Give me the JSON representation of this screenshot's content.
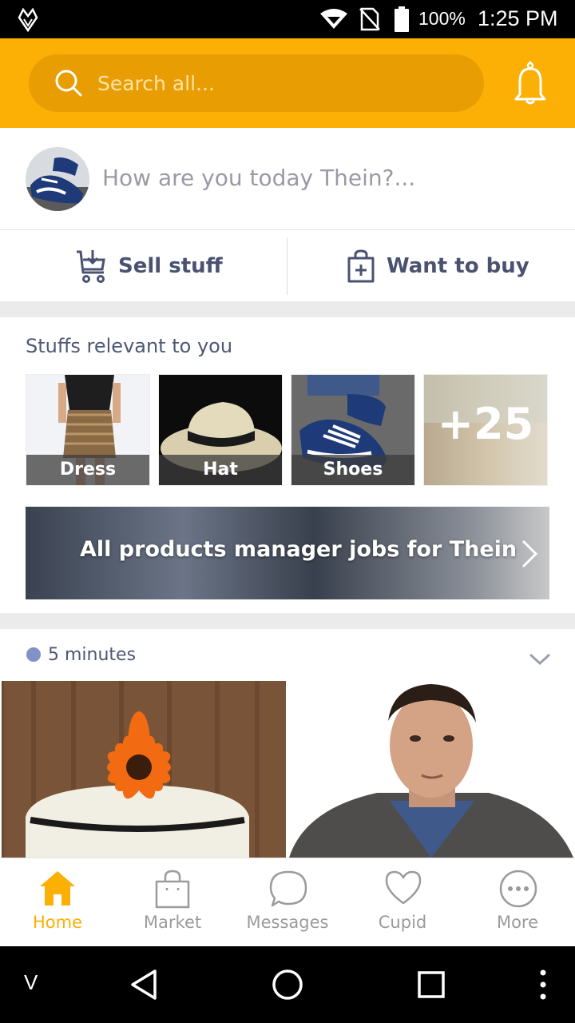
{
  "status_bar": {
    "battery_percent": "100%",
    "time": "1:25 PM",
    "icons": [
      "app-logo-icon",
      "wifi-icon",
      "no-sim-icon",
      "battery-icon"
    ]
  },
  "header": {
    "search_placeholder": "Search all...",
    "bell_icon": "bell-icon"
  },
  "composer": {
    "prompt": "How are you today Thein?..."
  },
  "actions": {
    "sell_label": "Sell stuff",
    "buy_label": "Want to buy"
  },
  "relevant": {
    "title": "Stuffs relevant to you",
    "items": [
      {
        "label": "Dress"
      },
      {
        "label": "Hat"
      },
      {
        "label": "Shoes"
      }
    ],
    "more_count": "+25",
    "jobs_banner": "All products manager jobs for Thein"
  },
  "feed": {
    "time_ago": "5 minutes"
  },
  "bottom_nav": {
    "items": [
      {
        "label": "Home",
        "icon": "home-icon",
        "active": true
      },
      {
        "label": "Market",
        "icon": "shopping-bag-icon",
        "active": false
      },
      {
        "label": "Messages",
        "icon": "chat-bubble-icon",
        "active": false
      },
      {
        "label": "Cupid",
        "icon": "heart-icon",
        "active": false
      },
      {
        "label": "More",
        "icon": "more-dots-icon",
        "active": false
      }
    ]
  },
  "system_nav": {
    "left_label": "V"
  },
  "colors": {
    "accent": "#fcaf05",
    "search_bg": "#e89e02",
    "text_primary": "#4a5270",
    "feed_dot": "#8392c6"
  }
}
